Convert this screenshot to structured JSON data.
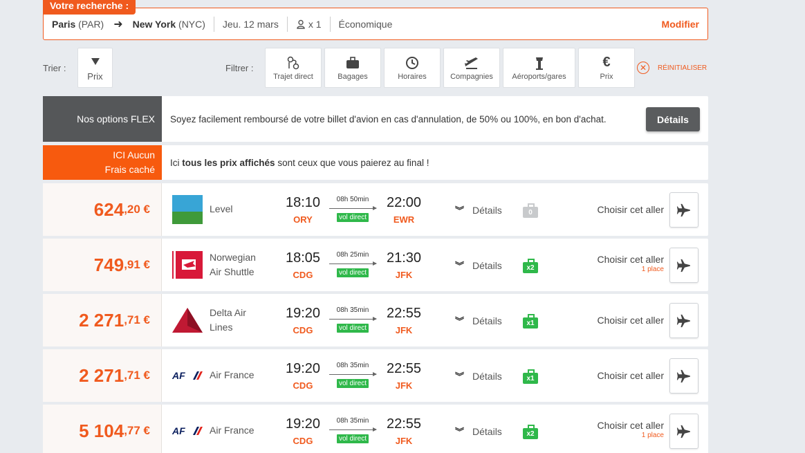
{
  "search": {
    "tag": "Votre recherche :",
    "from_city": "Paris",
    "from_code": "(PAR)",
    "to_city": "New York",
    "to_code": "(NYC)",
    "date": "Jeu. 12 mars",
    "passengers": "x 1",
    "cabin": "Économique",
    "modify": "Modifier"
  },
  "sort": {
    "label": "Trier :",
    "value": "Prix"
  },
  "filter": {
    "label": "Filtrer :",
    "items": [
      "Trajet direct",
      "Bagages",
      "Horaires",
      "Compagnies",
      "Aéroports/gares",
      "Prix"
    ],
    "reset": "RÉINITIALISER"
  },
  "flex_banner": {
    "title": "Nos options FLEX",
    "text": "Soyez facilement remboursé de votre billet d'avion en cas d'annulation, de 50% ou 100%, en bon d'achat.",
    "button": "Détails"
  },
  "fee_banner": {
    "title_1": "ICI Aucun",
    "title_2": "Frais caché",
    "text_pre": "Ici ",
    "text_bold": "tous les prix affichés",
    "text_post": " sont ceux que vous paierez au final !"
  },
  "flights": [
    {
      "price_int": "624",
      "price_dec": ",20 €",
      "airline_1": "Level",
      "airline_2": "",
      "dep_time": "18:10",
      "dep_airport": "ORY",
      "duration": "08h 50min",
      "direct": "vol direct",
      "arr_time": "22:00",
      "arr_airport": "EWR",
      "details": "Détails",
      "bags": "0",
      "choose": "Choisir cet aller",
      "seats": ""
    },
    {
      "price_int": "749",
      "price_dec": ",91 €",
      "airline_1": "Norwegian",
      "airline_2": "Air Shuttle",
      "dep_time": "18:05",
      "dep_airport": "CDG",
      "duration": "08h 25min",
      "direct": "vol direct",
      "arr_time": "21:30",
      "arr_airport": "JFK",
      "details": "Détails",
      "bags": "x2",
      "choose": "Choisir cet aller",
      "seats": "1 place"
    },
    {
      "price_int": "2 271",
      "price_dec": ",71 €",
      "airline_1": "Delta Air",
      "airline_2": "Lines",
      "dep_time": "19:20",
      "dep_airport": "CDG",
      "duration": "08h 35min",
      "direct": "vol direct",
      "arr_time": "22:55",
      "arr_airport": "JFK",
      "details": "Détails",
      "bags": "x1",
      "choose": "Choisir cet aller",
      "seats": ""
    },
    {
      "price_int": "2 271",
      "price_dec": ",71 €",
      "airline_1": "Air France",
      "airline_2": "",
      "dep_time": "19:20",
      "dep_airport": "CDG",
      "duration": "08h 35min",
      "direct": "vol direct",
      "arr_time": "22:55",
      "arr_airport": "JFK",
      "details": "Détails",
      "bags": "x1",
      "choose": "Choisir cet aller",
      "seats": ""
    },
    {
      "price_int": "5 104",
      "price_dec": ",77 €",
      "airline_1": "Air France",
      "airline_2": "",
      "dep_time": "19:20",
      "dep_airport": "CDG",
      "duration": "08h 35min",
      "direct": "vol direct",
      "arr_time": "22:55",
      "arr_airport": "JFK",
      "details": "Détails",
      "bags": "x2",
      "choose": "Choisir cet aller",
      "seats": "1 place"
    }
  ],
  "colors": {
    "accent": "#f05a1e",
    "direct_green": "#2fb84a",
    "flex_grey": "#555759",
    "fee_orange": "#f75a0e"
  }
}
